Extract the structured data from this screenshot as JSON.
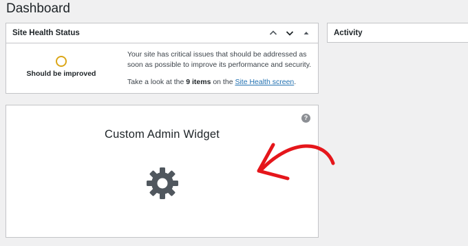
{
  "page": {
    "title": "Dashboard"
  },
  "site_health": {
    "title": "Site Health Status",
    "status_label": "Should be improved",
    "description": "Your site has critical issues that should be addressed as soon as possible to improve its performance and security.",
    "cta_prefix": "Take a look at the ",
    "cta_count": "9 items",
    "cta_middle": " on the ",
    "cta_link": "Site Health screen",
    "cta_suffix": ".",
    "status_color": "#dba617"
  },
  "activity": {
    "title": "Activity"
  },
  "custom_widget": {
    "title": "Custom Admin Widget",
    "help_glyph": "?",
    "icon": "gear-icon"
  },
  "annotation": {
    "color": "#e5161b",
    "icon": "hand-drawn-arrow"
  }
}
